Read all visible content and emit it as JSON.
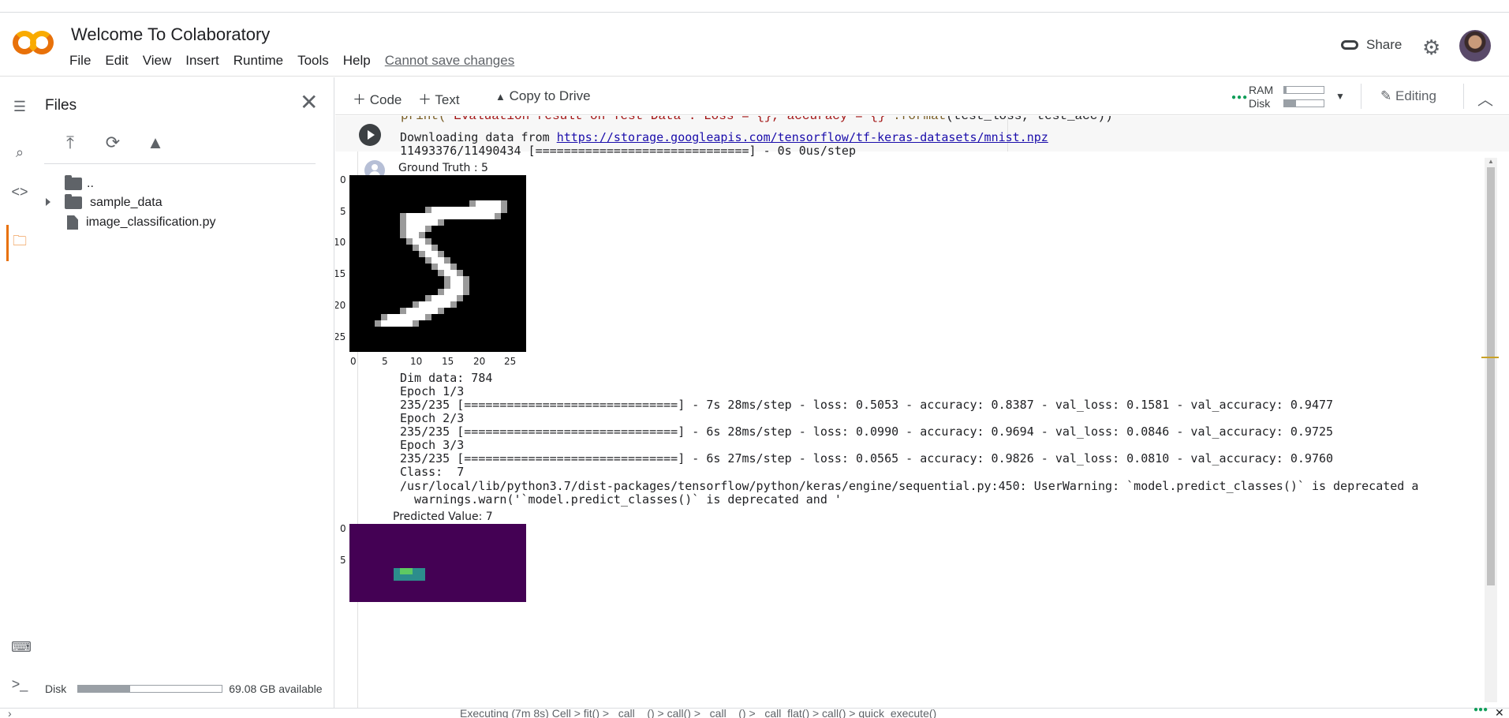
{
  "app": {
    "title": "Welcome To Colaboratory",
    "menu": [
      "File",
      "Edit",
      "View",
      "Insert",
      "Runtime",
      "Tools",
      "Help"
    ],
    "save_status": "Cannot save changes",
    "share_label": "Share"
  },
  "colors": {
    "accent_orange": "#e8710a",
    "logo_yellow": "#f9ab00",
    "link_blue": "#1a0dab",
    "ok_green": "#0f9d58"
  },
  "files_panel": {
    "title": "Files",
    "tree": [
      {
        "label": "..",
        "icon": "folder-up-icon"
      },
      {
        "label": "sample_data",
        "icon": "folder-icon"
      },
      {
        "label": "image_classification.py",
        "icon": "file-icon"
      }
    ],
    "disk_label": "Disk",
    "disk_available": "69.08 GB available",
    "disk_used_fraction": 0.36
  },
  "toolbar": {
    "code_label": "Code",
    "text_label": "Text",
    "drive_label": "Copy to Drive",
    "ram_label": "RAM",
    "disk_label": "Disk",
    "ram_used_fraction": 0.05,
    "disk_used_fraction": 0.3,
    "editing_label": "Editing"
  },
  "cell": {
    "code_line_pre": "print(",
    "code_line_str": "'Evaluation result on Test Data : Loss = {}, accuracy = {}'",
    "code_line_fmt": ".format",
    "code_line_args": "(test_loss, test_acc))"
  },
  "output": {
    "download_prefix": "Downloading data from ",
    "download_url": "https://storage.googleapis.com/tensorflow/tf-keras-datasets/mnist.npz",
    "download_progress": "11493376/11490434 [==============================] - 0s 0us/step",
    "plot1_title": "Ground Truth : 5",
    "dim_data": "Dim data: 784",
    "epoch1": "Epoch 1/3",
    "epoch1_line": "235/235 [==============================] - 7s 28ms/step - loss: 0.5053 - accuracy: 0.8387 - val_loss: 0.1581 - val_accuracy: 0.9477",
    "epoch2": "Epoch 2/3",
    "epoch2_line": "235/235 [==============================] - 6s 28ms/step - loss: 0.0990 - accuracy: 0.9694 - val_loss: 0.0846 - val_accuracy: 0.9725",
    "epoch3": "Epoch 3/3",
    "epoch3_line": "235/235 [==============================] - 6s 27ms/step - loss: 0.0565 - accuracy: 0.9826 - val_loss: 0.0810 - val_accuracy: 0.9760",
    "class_line": "Class:  7",
    "warning_line": "/usr/local/lib/python3.7/dist-packages/tensorflow/python/keras/engine/sequential.py:450: UserWarning: `model.predict_classes()` is deprecated a",
    "warning_line2": "  warnings.warn('`model.predict_classes()` is deprecated and '",
    "plot2_title": "Predicted Value: 7"
  },
  "plot1": {
    "y_ticks": [
      "0",
      "5",
      "10",
      "15",
      "20",
      "25"
    ],
    "x_ticks": [
      "0",
      "5",
      "10",
      "15",
      "20",
      "25"
    ]
  },
  "plot2": {
    "y_ticks": [
      "0",
      "5"
    ]
  },
  "status": {
    "executing": "Executing (7m 8s)  Cell > fit() >  _call__() > call() >  _call__() > _call_flat() > call() > quick_execute()"
  }
}
